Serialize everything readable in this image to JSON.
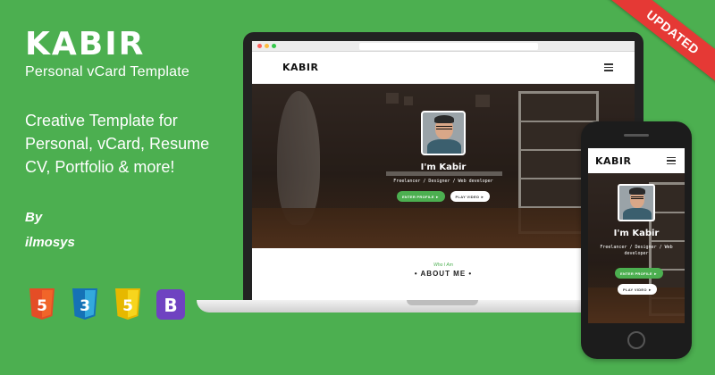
{
  "brand": {
    "name": "KABIR",
    "subtitle": "Personal vCard Template"
  },
  "description": [
    "Creative Template for",
    "Personal, vCard, Resume",
    "CV, Portfolio & more!"
  ],
  "author": {
    "by": "By",
    "name": "ilmosys"
  },
  "badges": [
    {
      "icon": "html5-icon",
      "label": "5",
      "color": "#e44d26"
    },
    {
      "icon": "css3-icon",
      "label": "3",
      "color": "#2965f1"
    },
    {
      "icon": "javascript-icon",
      "label": "5",
      "color": "#f0c419"
    },
    {
      "icon": "bootstrap-icon",
      "label": "B",
      "color": "#6f42c1"
    }
  ],
  "ribbon": "UPDATED",
  "preview": {
    "logo": "KABIR",
    "hero_name": "I'm Kabir",
    "hero_role": "Freelancer / Designer / Web developer",
    "btn_primary": "ENTER PROFILE ►",
    "btn_secondary": "PLAY VIDEO ►",
    "about_small": "Who I Am",
    "about_title": "• ABOUT ME •"
  },
  "colors": {
    "background": "#4caf50",
    "accent": "#4caf50",
    "ribbon": "#e53935"
  }
}
